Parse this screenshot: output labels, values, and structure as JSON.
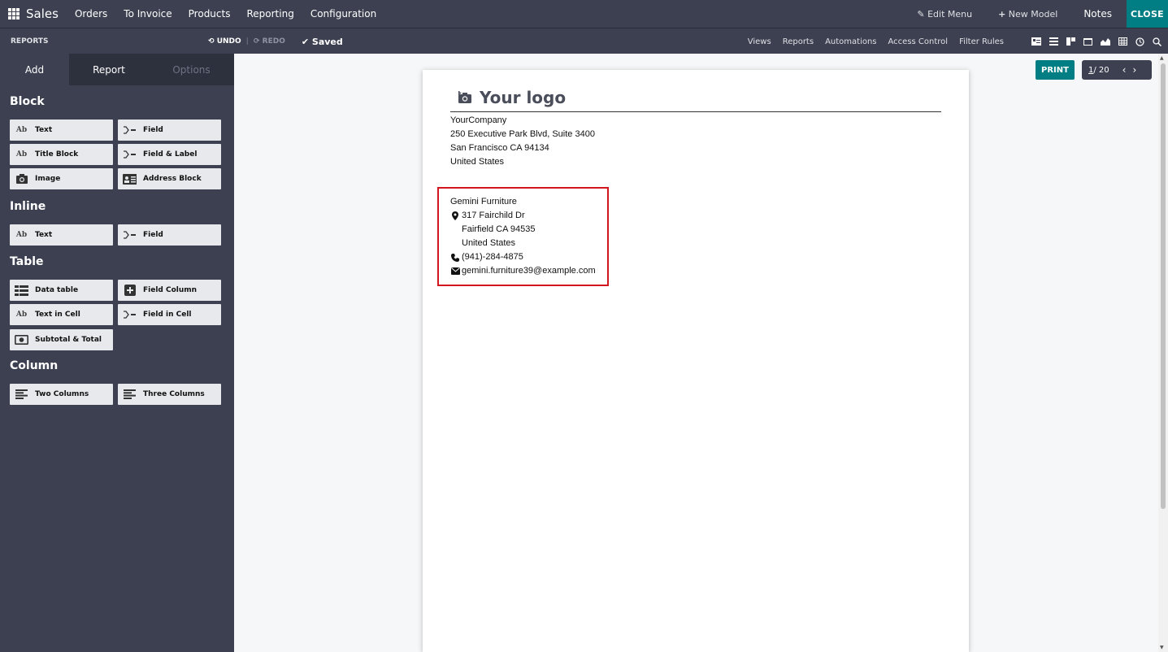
{
  "topnav": {
    "app_name": "Sales",
    "menu": [
      "Orders",
      "To Invoice",
      "Products",
      "Reporting",
      "Configuration"
    ],
    "edit_menu": "Edit Menu",
    "new_model": "New Model",
    "notes": "Notes",
    "close": "CLOSE"
  },
  "subbar": {
    "crumb": "REPORTS",
    "undo": "UNDO",
    "redo": "REDO",
    "saved": "Saved",
    "links": [
      "Views",
      "Reports",
      "Automations",
      "Access Control",
      "Filter Rules"
    ]
  },
  "sidebar": {
    "tabs": [
      "Add",
      "Report",
      "Options"
    ],
    "sections": {
      "block": "Block",
      "inline": "Inline",
      "table": "Table",
      "column": "Column"
    },
    "block_items": [
      "Text",
      "Field",
      "Title Block",
      "Field & Label",
      "Image",
      "Address Block"
    ],
    "inline_items": [
      "Text",
      "Field"
    ],
    "table_items": [
      "Data table",
      "Field Column",
      "Text in Cell",
      "Field in Cell",
      "Subtotal & Total"
    ],
    "column_items": [
      "Two Columns",
      "Three Columns"
    ],
    "icon_text": "Ab"
  },
  "report": {
    "logo_text": "Your logo",
    "company_lines": [
      "YourCompany",
      "250 Executive Park Blvd, Suite 3400",
      "San Francisco CA 94134",
      "United States"
    ],
    "customer": {
      "name": "Gemini Furniture",
      "street": "317 Fairchild Dr",
      "city": "Fairfield CA 94535",
      "country": "United States",
      "phone": "(941)-284-4875",
      "email": "gemini.furniture39@example.com"
    }
  },
  "controls": {
    "print": "PRINT",
    "pager_current": "1",
    "pager_total": "/ 20"
  },
  "colors": {
    "nav_bg": "#3c4050",
    "accent": "#017e84",
    "highlight_border": "#d2161d"
  }
}
